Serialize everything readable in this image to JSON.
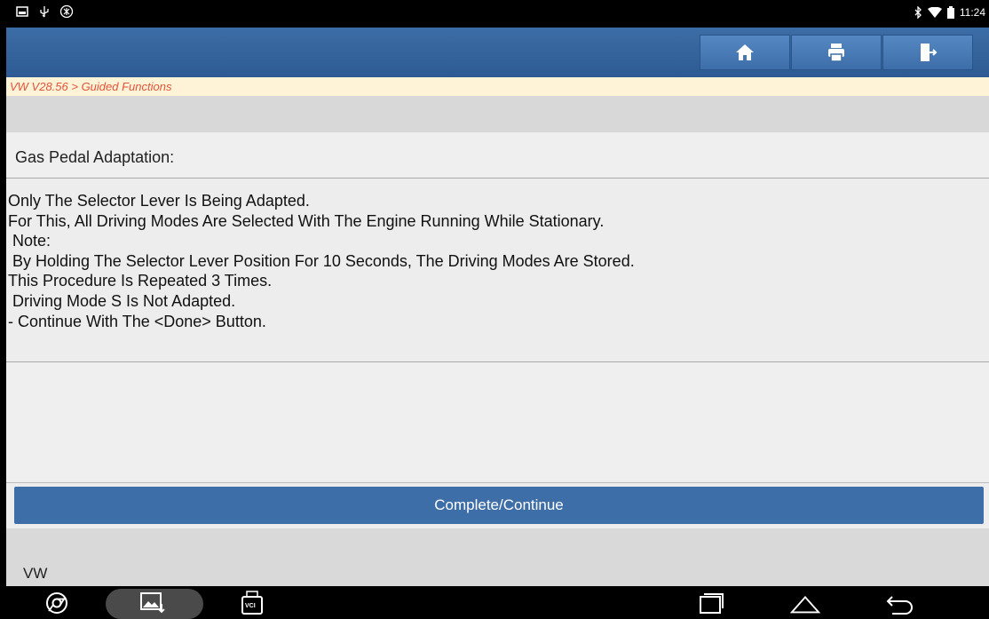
{
  "status_bar": {
    "time": "11:24",
    "icons_left": [
      "gallery-icon",
      "usb-icon",
      "settings-icon"
    ],
    "icons_right": [
      "bluetooth-icon",
      "wifi-icon",
      "battery-icon"
    ]
  },
  "header": {
    "buttons": [
      "home-icon",
      "print-icon",
      "exit-icon"
    ]
  },
  "breadcrumb": "VW V28.56 > Guided Functions",
  "section_title": "Gas Pedal Adaptation:",
  "content_lines": [
    "Only The Selector Lever Is Being Adapted.",
    "For This, All Driving Modes Are Selected With The Engine Running While Stationary.",
    " Note:",
    " By Holding The Selector Lever Position For 10 Seconds, The Driving Modes Are Stored.",
    "This Procedure Is Repeated 3 Times.",
    " Driving Mode S Is Not Adapted.",
    "- Continue With The <Done> Button."
  ],
  "primary_button": "Complete/Continue",
  "footer_label": "VW",
  "nav_icons": {
    "vci_label": "VCI"
  },
  "colors": {
    "header": "#2d5a93",
    "breadcrumb_text": "#e1533a",
    "button": "#3e6ea8"
  }
}
